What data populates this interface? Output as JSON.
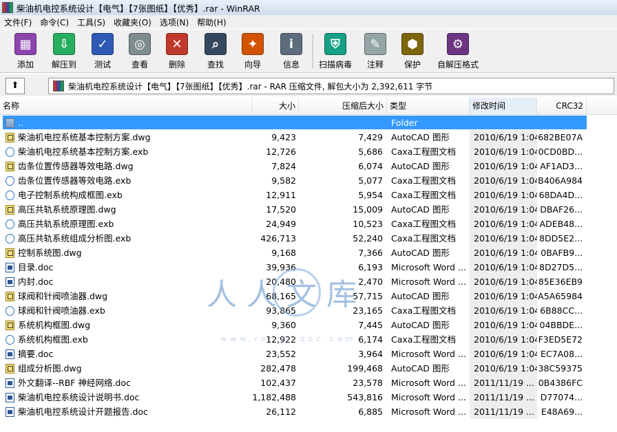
{
  "window": {
    "title": "柴油机电控系统设计【电气】【7张图纸】【优秀】.rar - WinRAR"
  },
  "menu": [
    "文件(F)",
    "命令(C)",
    "工具(S)",
    "收藏夹(O)",
    "选项(N)",
    "帮助(H)"
  ],
  "toolbar": [
    {
      "label": "添加",
      "icon": "add-archive-icon",
      "color": "#8e44ad"
    },
    {
      "label": "解压到",
      "icon": "extract-to-icon",
      "color": "#27ae60"
    },
    {
      "label": "测试",
      "icon": "test-archive-icon",
      "color": "#2f59b5"
    },
    {
      "label": "查看",
      "icon": "view-glasses-icon",
      "color": "#7f8c8d"
    },
    {
      "label": "删除",
      "icon": "delete-icon",
      "color": "#c0392b"
    },
    {
      "label": "查找",
      "icon": "find-binoculars-icon",
      "color": "#34495e"
    },
    {
      "label": "向导",
      "icon": "wizard-icon",
      "color": "#d35400"
    },
    {
      "label": "信息",
      "icon": "info-icon",
      "color": "#5d6d7e"
    },
    {
      "label": "扫描病毒",
      "icon": "virus-scan-icon",
      "color": "#16a085"
    },
    {
      "label": "注释",
      "icon": "comment-icon",
      "color": "#95a5a6"
    },
    {
      "label": "保护",
      "icon": "protect-shield-icon",
      "color": "#7d6608"
    },
    {
      "label": "自解压格式",
      "icon": "sfx-icon",
      "color": "#6c3483"
    }
  ],
  "address": {
    "text": "柴油机电控系统设计【电气】【7张图纸】【优秀】.rar - RAR 压缩文件, 解包大小为 2,392,611 字节"
  },
  "columns": {
    "name": "名称",
    "size": "大小",
    "packed": "压缩后大小",
    "type": "类型",
    "modified": "修改时间",
    "crc": "CRC32"
  },
  "files": [
    {
      "name": "..",
      "size": "",
      "packed": "",
      "type": "Folder",
      "modified": "",
      "crc": "",
      "kind": "folder",
      "selected": true
    },
    {
      "name": "柴油机电控系统基本控制方案.dwg",
      "size": "9,423",
      "packed": "7,429",
      "type": "AutoCAD 图形",
      "modified": "2010/6/19 1:04",
      "crc": "682BE07A",
      "kind": "dwg"
    },
    {
      "name": "柴油机电控系统基本控制方案.exb",
      "size": "12,726",
      "packed": "5,686",
      "type": "Caxa工程图文档",
      "modified": "2010/6/19 1:04",
      "crc": "0CD0BD...",
      "kind": "exb"
    },
    {
      "name": "齿条位置传感器等效电路.dwg",
      "size": "7,824",
      "packed": "6,074",
      "type": "AutoCAD 图形",
      "modified": "2010/6/19 1:04",
      "crc": "AF1AD3...",
      "kind": "dwg"
    },
    {
      "name": "齿条位置传感器等效电路.exb",
      "size": "9,582",
      "packed": "5,077",
      "type": "Caxa工程图文档",
      "modified": "2010/6/19 1:04",
      "crc": "B406A984",
      "kind": "exb"
    },
    {
      "name": "电子控制系统构成框图.exb",
      "size": "12,911",
      "packed": "5,954",
      "type": "Caxa工程图文档",
      "modified": "2010/6/19 1:04",
      "crc": "68DA4D...",
      "kind": "exb"
    },
    {
      "name": "高压共轨系统原理图.dwg",
      "size": "17,520",
      "packed": "15,009",
      "type": "AutoCAD 图形",
      "modified": "2010/6/19 1:04",
      "crc": "DBAF26...",
      "kind": "dwg"
    },
    {
      "name": "高压共轨系统原理图.exb",
      "size": "24,949",
      "packed": "10,523",
      "type": "Caxa工程图文档",
      "modified": "2010/6/19 1:04",
      "crc": "ADEB48...",
      "kind": "exb"
    },
    {
      "name": "高压共轨系统组成分析图.exb",
      "size": "426,713",
      "packed": "52,240",
      "type": "Caxa工程图文档",
      "modified": "2010/6/19 1:04",
      "crc": "8DD5E2...",
      "kind": "exb"
    },
    {
      "name": "控制系统图.dwg",
      "size": "9,168",
      "packed": "7,366",
      "type": "AutoCAD 图形",
      "modified": "2010/6/19 1:04",
      "crc": "0BAFB9...",
      "kind": "dwg"
    },
    {
      "name": "目录.doc",
      "size": "39,936",
      "packed": "6,193",
      "type": "Microsoft Word ...",
      "modified": "2010/6/19 1:04",
      "crc": "8D27D5...",
      "kind": "doc"
    },
    {
      "name": "内封.doc",
      "size": "20,480",
      "packed": "2,470",
      "type": "Microsoft Word ...",
      "modified": "2010/6/19 1:04",
      "crc": "85E36EB9",
      "kind": "doc"
    },
    {
      "name": "球阀和针阀喷油器.dwg",
      "size": "68,165",
      "packed": "57,715",
      "type": "AutoCAD 图形",
      "modified": "2010/6/19 1:04",
      "crc": "A5A65984",
      "kind": "dwg"
    },
    {
      "name": "球阀和针阀喷油器.exb",
      "size": "93,865",
      "packed": "23,165",
      "type": "Caxa工程图文档",
      "modified": "2010/6/19 1:04",
      "crc": "6B88CC...",
      "kind": "exb"
    },
    {
      "name": "系统机构框图.dwg",
      "size": "9,360",
      "packed": "7,445",
      "type": "AutoCAD 图形",
      "modified": "2010/6/19 1:04",
      "crc": "04BBDE...",
      "kind": "dwg"
    },
    {
      "name": "系统机构框图.exb",
      "size": "12,922",
      "packed": "6,174",
      "type": "Caxa工程图文档",
      "modified": "2010/6/19 1:04",
      "crc": "F3ED5E72",
      "kind": "exb"
    },
    {
      "name": "摘要.doc",
      "size": "23,552",
      "packed": "3,964",
      "type": "Microsoft Word ...",
      "modified": "2010/6/19 1:04",
      "crc": "EC7A08...",
      "kind": "doc"
    },
    {
      "name": "组成分析图.dwg",
      "size": "282,478",
      "packed": "199,468",
      "type": "AutoCAD 图形",
      "modified": "2010/6/19 1:04",
      "crc": "38C59375",
      "kind": "dwg"
    },
    {
      "name": "外文翻译--RBF 神经网络.doc",
      "size": "102,437",
      "packed": "23,578",
      "type": "Microsoft Word ...",
      "modified": "2011/11/19 ...",
      "crc": "0B4386FC",
      "kind": "doc"
    },
    {
      "name": "柴油机电控系统设计说明书.doc",
      "size": "1,182,488",
      "packed": "543,816",
      "type": "Microsoft Word ...",
      "modified": "2011/11/19 ...",
      "crc": "D77074...",
      "kind": "doc"
    },
    {
      "name": "柴油机电控系统设计开题报告.doc",
      "size": "26,112",
      "packed": "6,885",
      "type": "Microsoft Word ...",
      "modified": "2011/11/19 ...",
      "crc": "E48A69...",
      "kind": "doc"
    }
  ],
  "watermark": {
    "text": "人人文库",
    "url": "www.renrendoc.com"
  }
}
